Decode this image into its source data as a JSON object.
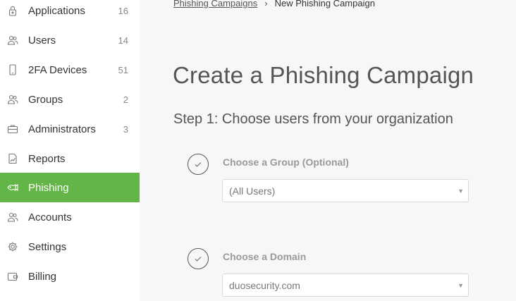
{
  "sidebar": {
    "items": [
      {
        "label": "Applications",
        "count": "16",
        "icon": "lock-icon"
      },
      {
        "label": "Users",
        "count": "14",
        "icon": "users-icon"
      },
      {
        "label": "2FA Devices",
        "count": "51",
        "icon": "phone-icon"
      },
      {
        "label": "Groups",
        "count": "2",
        "icon": "groups-icon"
      },
      {
        "label": "Administrators",
        "count": "3",
        "icon": "briefcase-icon"
      },
      {
        "label": "Reports",
        "count": "",
        "icon": "report-icon"
      },
      {
        "label": "Phishing",
        "count": "",
        "icon": "fish-icon",
        "active": true
      },
      {
        "label": "Accounts",
        "count": "",
        "icon": "accounts-icon"
      },
      {
        "label": "Settings",
        "count": "",
        "icon": "gear-icon"
      },
      {
        "label": "Billing",
        "count": "",
        "icon": "wallet-icon"
      }
    ],
    "active_color": "#64b548"
  },
  "breadcrumb": {
    "parent": "Phishing Campaigns",
    "current": "New Phishing Campaign"
  },
  "main": {
    "title": "Create a Phishing Campaign",
    "step1": "Step 1: Choose users from your organization",
    "group_field": {
      "label": "Choose a Group (Optional)",
      "value": "(All Users)"
    },
    "domain_field": {
      "label": "Choose a Domain",
      "value": "duosecurity.com"
    }
  }
}
